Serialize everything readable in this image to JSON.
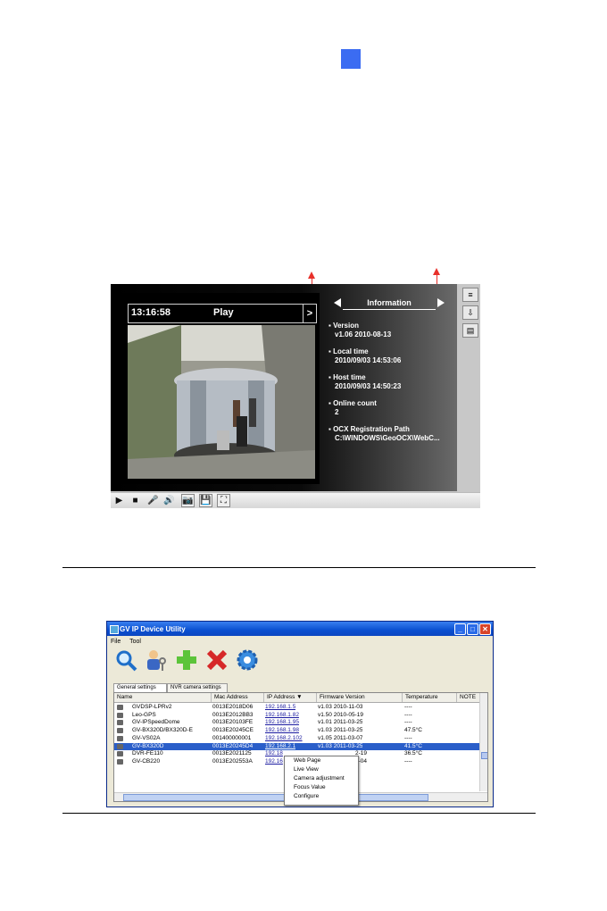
{
  "viewer": {
    "time": "13:16:58",
    "mode": "Play",
    "next": ">",
    "info_title": "Information",
    "info": [
      {
        "key": "Version",
        "value": "v1.06  2010-08-13"
      },
      {
        "key": "Local time",
        "value": "2010/09/03 14:53:06"
      },
      {
        "key": "Host time",
        "value": "2010/09/03 14:50:23"
      },
      {
        "key": "Online count",
        "value": "2"
      },
      {
        "key": "OCX Registration Path",
        "value": "C:\\WINDOWS\\GeoOCX\\WebC..."
      }
    ],
    "controls": [
      "play-icon",
      "stop-icon",
      "microphone-icon",
      "speaker-icon",
      "snapshot-icon",
      "save-icon",
      "fullscreen-icon"
    ]
  },
  "utility": {
    "title": "GV IP Device Utility",
    "menu": [
      "File",
      "Tool"
    ],
    "tabs": [
      "General settings",
      "NVR camera settings"
    ],
    "columns": [
      "Name",
      "Mac Address",
      "IP Address  ▼",
      "Firmware Version",
      "Temperature",
      "NOTE"
    ],
    "rows": [
      {
        "name": "GVDSP-LPRv2",
        "mac": "0013E2018D06",
        "ip": "192.168.1.5",
        "fw": "v1.03  2010-11-03",
        "temp": "----"
      },
      {
        "name": "Leo-GPS",
        "mac": "0013E2012BB3",
        "ip": "192.168.1.82",
        "fw": "v1.50  2010-05-19",
        "temp": "----"
      },
      {
        "name": "GV-IPSpeedDome",
        "mac": "0013E20103FE",
        "ip": "192.168.1.95",
        "fw": "v1.01  2011-03-25",
        "temp": "----"
      },
      {
        "name": "GV-BX320D/BX320D-E",
        "mac": "0013E20245CE",
        "ip": "192.168.1.98",
        "fw": "v1.03  2011-03-25",
        "temp": "47.5°C"
      },
      {
        "name": "GV-VS02A",
        "mac": "001400000001",
        "ip": "192.168.2.102",
        "fw": "v1.05  2011-03-07",
        "temp": "----"
      },
      {
        "name": "GV-BX320D",
        "mac": "0013E20245D4",
        "ip": "192.168.2.1",
        "fw": "v1.03  2011-03-25",
        "temp": "41.5°C"
      },
      {
        "name": "DVR-FE110",
        "mac": "0013E2021125",
        "ip": "192.18",
        "fw": "2-19",
        "temp": "36.5°C"
      },
      {
        "name": "GV-CB220",
        "mac": "0013E202553A",
        "ip": "192.16",
        "fw": "3-04",
        "temp": "----"
      }
    ],
    "context_menu": [
      "Web Page",
      "Live View",
      "Camera adjustment",
      "Focus Value",
      "Configure"
    ]
  }
}
